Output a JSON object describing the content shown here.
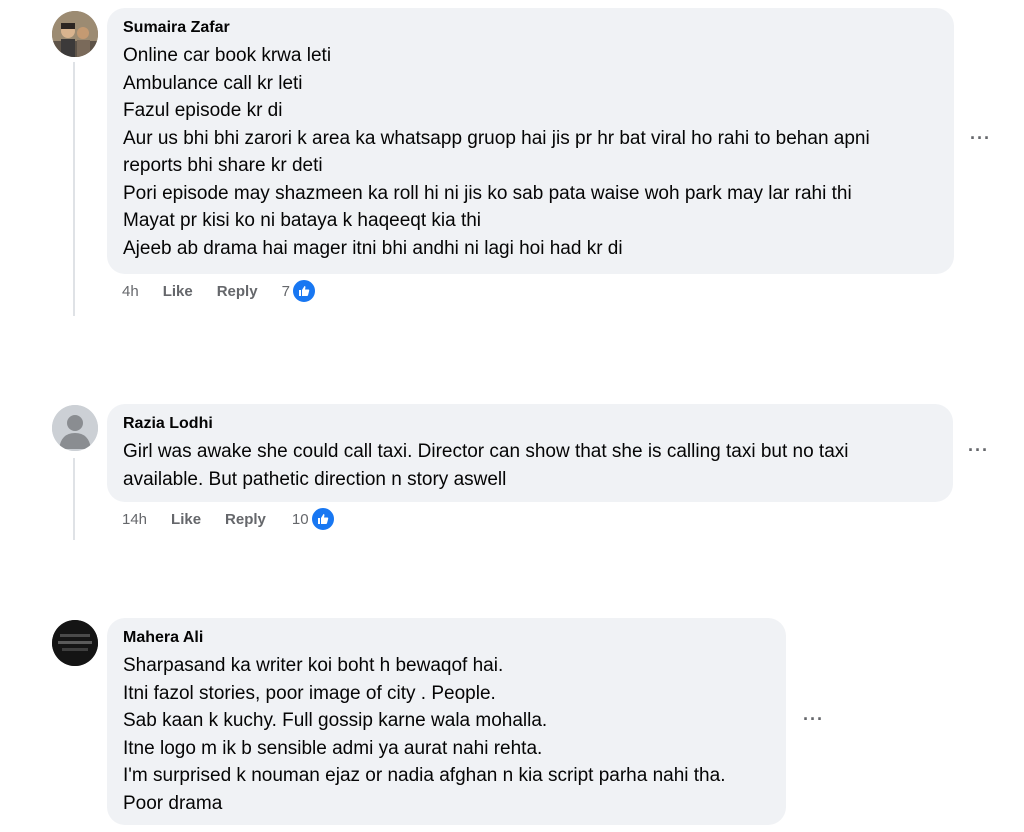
{
  "comments": [
    {
      "author": "Sumaira Zafar",
      "lines": [
        "Online car book krwa leti",
        "Ambulance call kr leti",
        "Fazul episode kr di",
        "Aur us bhi bhi zarori k area ka whatsapp gruop hai jis pr hr bat viral ho rahi to behan apni",
        "reports bhi share kr deti",
        "Pori episode may shazmeen ka roll hi ni jis ko sab pata waise woh park may lar rahi thi",
        "Mayat pr kisi ko ni bataya k haqeeqt kia thi",
        "Ajeeb ab drama hai mager itni bhi andhi ni lagi hoi had kr di"
      ],
      "time": "4h",
      "like_label": "Like",
      "reply_label": "Reply",
      "reaction_count": "7",
      "more_label": "···"
    },
    {
      "author": "Razia Lodhi",
      "lines": [
        "Girl was awake she could call taxi. Director can show that she is calling taxi but no taxi",
        "available. But pathetic direction n story aswell"
      ],
      "time": "14h",
      "like_label": "Like",
      "reply_label": "Reply",
      "reaction_count": "10",
      "more_label": "···"
    },
    {
      "author": "Mahera Ali",
      "lines": [
        "Sharpasand ka writer koi boht h bewaqof hai.",
        "Itni fazol stories, poor image of city . People.",
        "Sab kaan k kuchy. Full gossip karne wala mohalla.",
        "Itne logo m ik b sensible admi ya aurat nahi rehta.",
        "I'm surprised k nouman ejaz or nadia afghan n kia script parha nahi tha.",
        "Poor drama"
      ],
      "more_label": "···"
    }
  ],
  "colors": {
    "bubble": "#f0f2f5",
    "text": "#050505",
    "meta": "#65676b",
    "like_blue": "#1877f2"
  },
  "icons": [
    "user-avatar",
    "default-avatar-icon",
    "like-thumb-icon",
    "more-options-icon"
  ]
}
